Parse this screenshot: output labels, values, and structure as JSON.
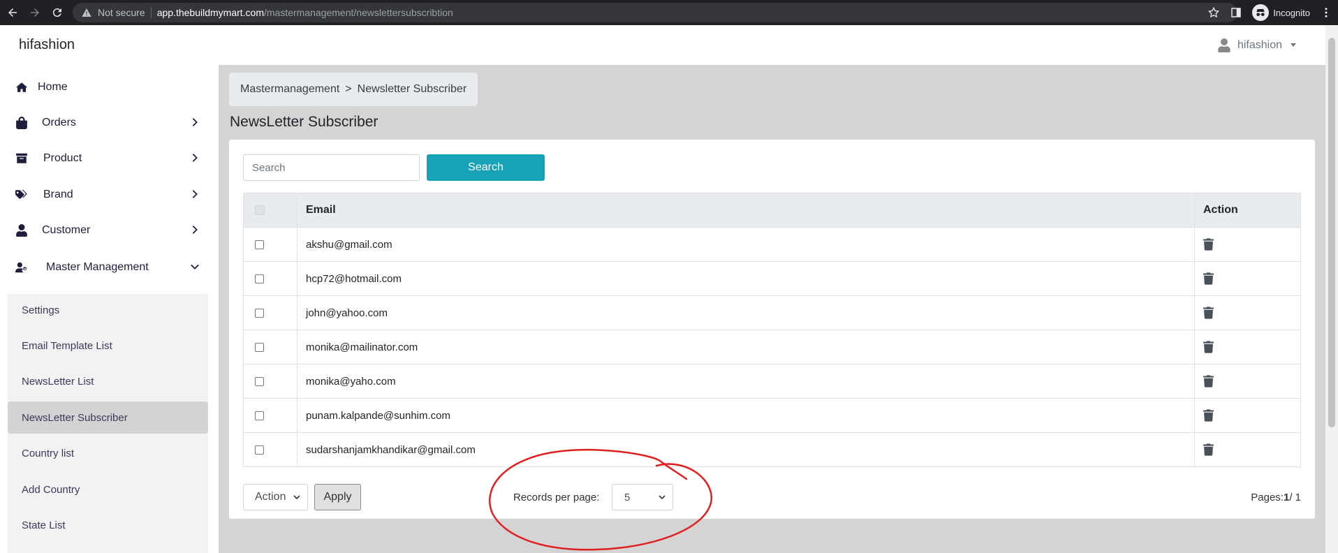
{
  "browser": {
    "security_label": "Not secure",
    "url_host": "app.thebuildmymart.com",
    "url_path": "/mastermanagement/newslettersubscribtion",
    "profile_label": "Incognito"
  },
  "header": {
    "brand": "hifashion",
    "user_name": "hifashion"
  },
  "sidebar": {
    "items": [
      {
        "label": "Home",
        "icon": "home-icon"
      },
      {
        "label": "Orders",
        "icon": "shopping-bag-icon"
      },
      {
        "label": "Product",
        "icon": "box-icon"
      },
      {
        "label": "Brand",
        "icon": "tags-icon"
      },
      {
        "label": "Customer",
        "icon": "user-icon"
      },
      {
        "label": "Master Management",
        "icon": "user-cog-icon"
      }
    ],
    "submenu": [
      {
        "label": "Settings"
      },
      {
        "label": "Email Template List"
      },
      {
        "label": "NewsLetter List"
      },
      {
        "label": "NewsLetter Subscriber"
      },
      {
        "label": "Country list"
      },
      {
        "label": "Add Country"
      },
      {
        "label": "State List"
      }
    ]
  },
  "breadcrumb": {
    "root": "Mastermanagement",
    "separator": ">",
    "current": "Newsletter Subscriber"
  },
  "page": {
    "title": "NewsLetter Subscriber"
  },
  "search": {
    "placeholder": "Search",
    "button_label": "Search"
  },
  "table": {
    "headers": {
      "email": "Email",
      "action": "Action"
    },
    "rows": [
      {
        "email": "akshu@gmail.com"
      },
      {
        "email": "hcp72@hotmail.com"
      },
      {
        "email": "john@yahoo.com"
      },
      {
        "email": "monika@mailinator.com"
      },
      {
        "email": "monika@yaho.com"
      },
      {
        "email": "punam.kalpande@sunhim.com"
      },
      {
        "email": "sudarshanjamkhandikar@gmail.com"
      }
    ]
  },
  "footer": {
    "action_select": "Action",
    "apply_label": "Apply",
    "records_label": "Records per page:",
    "records_value": "5",
    "pages_label": "Pages:",
    "pages_current": "1",
    "pages_total": "/ 1"
  },
  "colors": {
    "accent": "#17a2b8",
    "annotation": "#e02020",
    "main_bg": "#d4d4d4"
  }
}
